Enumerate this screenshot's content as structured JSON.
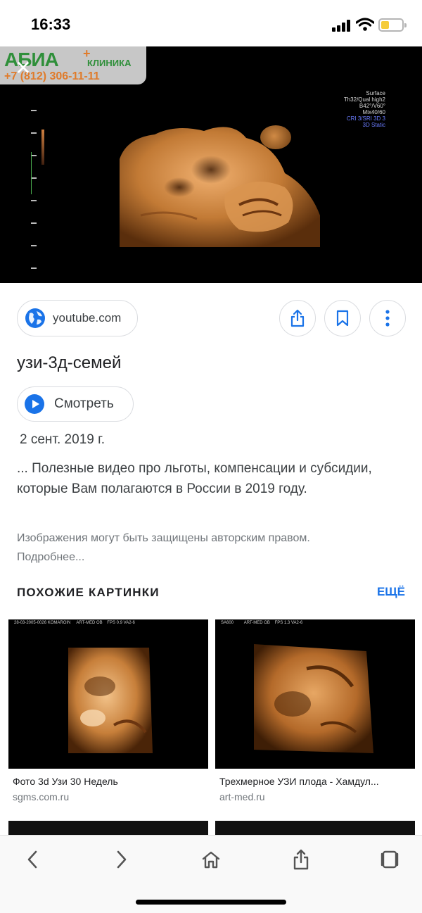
{
  "status_bar": {
    "time": "16:33"
  },
  "hero_image": {
    "logo_brand": "АБИА",
    "logo_sub": "КЛИНИКА",
    "logo_phone": "+7 (812) 306-11-11",
    "scanner_settings": [
      "Surface",
      "Th32/Qual high2",
      "B42°/V60°",
      "Mix40/60"
    ],
    "scanner_settings_blue": [
      "CRI 3/SRI 3D 3",
      "3D Static"
    ],
    "mode_label": "3D"
  },
  "source": {
    "domain": "youtube.com",
    "icons": [
      "globe-icon",
      "share-icon",
      "bookmark-icon",
      "more-vert-icon"
    ]
  },
  "result": {
    "title": "узи-3д-семей",
    "watch_label": "Смотреть",
    "date": "2 сент. 2019 г.",
    "snippet": "... Полезные видео про льготы, компенсации и субсидии, которые Вам полагаются в России в 2019 году.",
    "copyright_notice": "Изображения могут быть защищены авторским правом. Подробнее..."
  },
  "related": {
    "section_title": "ПОХОЖИЕ КАРТИНКИ",
    "more_label": "ЕЩЁ",
    "items": [
      {
        "caption": "Фото 3d Узи 30 Недель",
        "site": "sgms.com.ru",
        "header_left": "28-03-2005-0026 KOMAROIN",
        "header_mid": "ART-MED OB",
        "header_right": "FPS 0.9 VA2-6"
      },
      {
        "caption": "Трехмерное УЗИ плода - Хамдул...",
        "site": "art-med.ru",
        "header_left": "SA600",
        "header_mid": "ART-MED OB",
        "header_right": "FPS 1.3 VA2-6"
      }
    ]
  },
  "toolbar": {
    "icons": [
      "back-icon",
      "forward-icon",
      "home-icon",
      "share-icon",
      "tabs-icon"
    ]
  },
  "colors": {
    "accent": "#1a73e8",
    "text": "#202124",
    "secondary_text": "#70757a",
    "border": "#dadce0"
  }
}
